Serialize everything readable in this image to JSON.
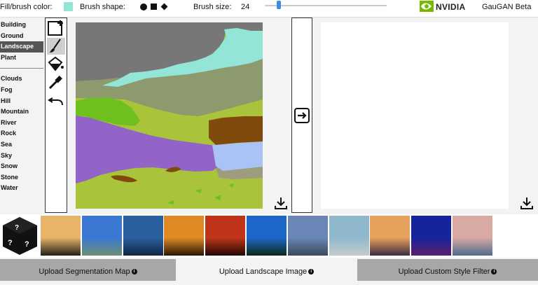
{
  "toolbar": {
    "fill_label": "Fill/brush color:",
    "fill_color": "#93e5d8",
    "shape_label": "Brush shape:",
    "shapes": [
      "circle",
      "square",
      "diamond"
    ],
    "size_label": "Brush size:",
    "size_value": "24",
    "slider_fraction": 0.1,
    "brand": "NVIDIA",
    "app_title": "GauGAN Beta"
  },
  "labels": {
    "group1": [
      "Building",
      "Ground",
      "Landscape",
      "Plant"
    ],
    "selected": "Landscape",
    "group2": [
      "Clouds",
      "Fog",
      "Hill",
      "Mountain",
      "River",
      "Rock",
      "Sea",
      "Sky",
      "Snow",
      "Stone",
      "Water"
    ]
  },
  "tools": [
    "new-canvas-icon",
    "brush-icon",
    "paint-bucket-icon",
    "eyedropper-icon",
    "undo-icon"
  ],
  "colors": {
    "sky_gray": "#777777",
    "clouds": "#93e5d8",
    "hill": "#8c9a6e",
    "grass": "#a9c43b",
    "plant": "#6fbf1e",
    "mountain": "#9264c8",
    "sea": "#a9c3f5",
    "rock": "#7f4a0b",
    "stone": "#9d9c7d"
  },
  "style_thumbnails": [
    {
      "sky": "#e8b46a",
      "ground": "#222018"
    },
    {
      "sky": "#3a78d4",
      "ground": "#6b8f74"
    },
    {
      "sky": "#2a5fa0",
      "ground": "#102644"
    },
    {
      "sky": "#e08a25",
      "ground": "#2a1606"
    },
    {
      "sky": "#c0351a",
      "ground": "#200704"
    },
    {
      "sky": "#1d67c8",
      "ground": "#0b2b18"
    },
    {
      "sky": "#6a86b6",
      "ground": "#3a4a5c"
    },
    {
      "sky": "#8fb8cc",
      "ground": "#c3cbcb"
    },
    {
      "sky": "#e6a15c",
      "ground": "#3b2c40"
    },
    {
      "sky": "#17239a",
      "ground": "#5b1f6b"
    },
    {
      "sky": "#d9a9a4",
      "ground": "#4e6b8b"
    }
  ],
  "bottom": {
    "upload_seg": "Upload Segmentation Map",
    "upload_landscape": "Upload Landscape Image",
    "upload_style": "Upload Custom Style Filter",
    "info_glyph": "i"
  }
}
